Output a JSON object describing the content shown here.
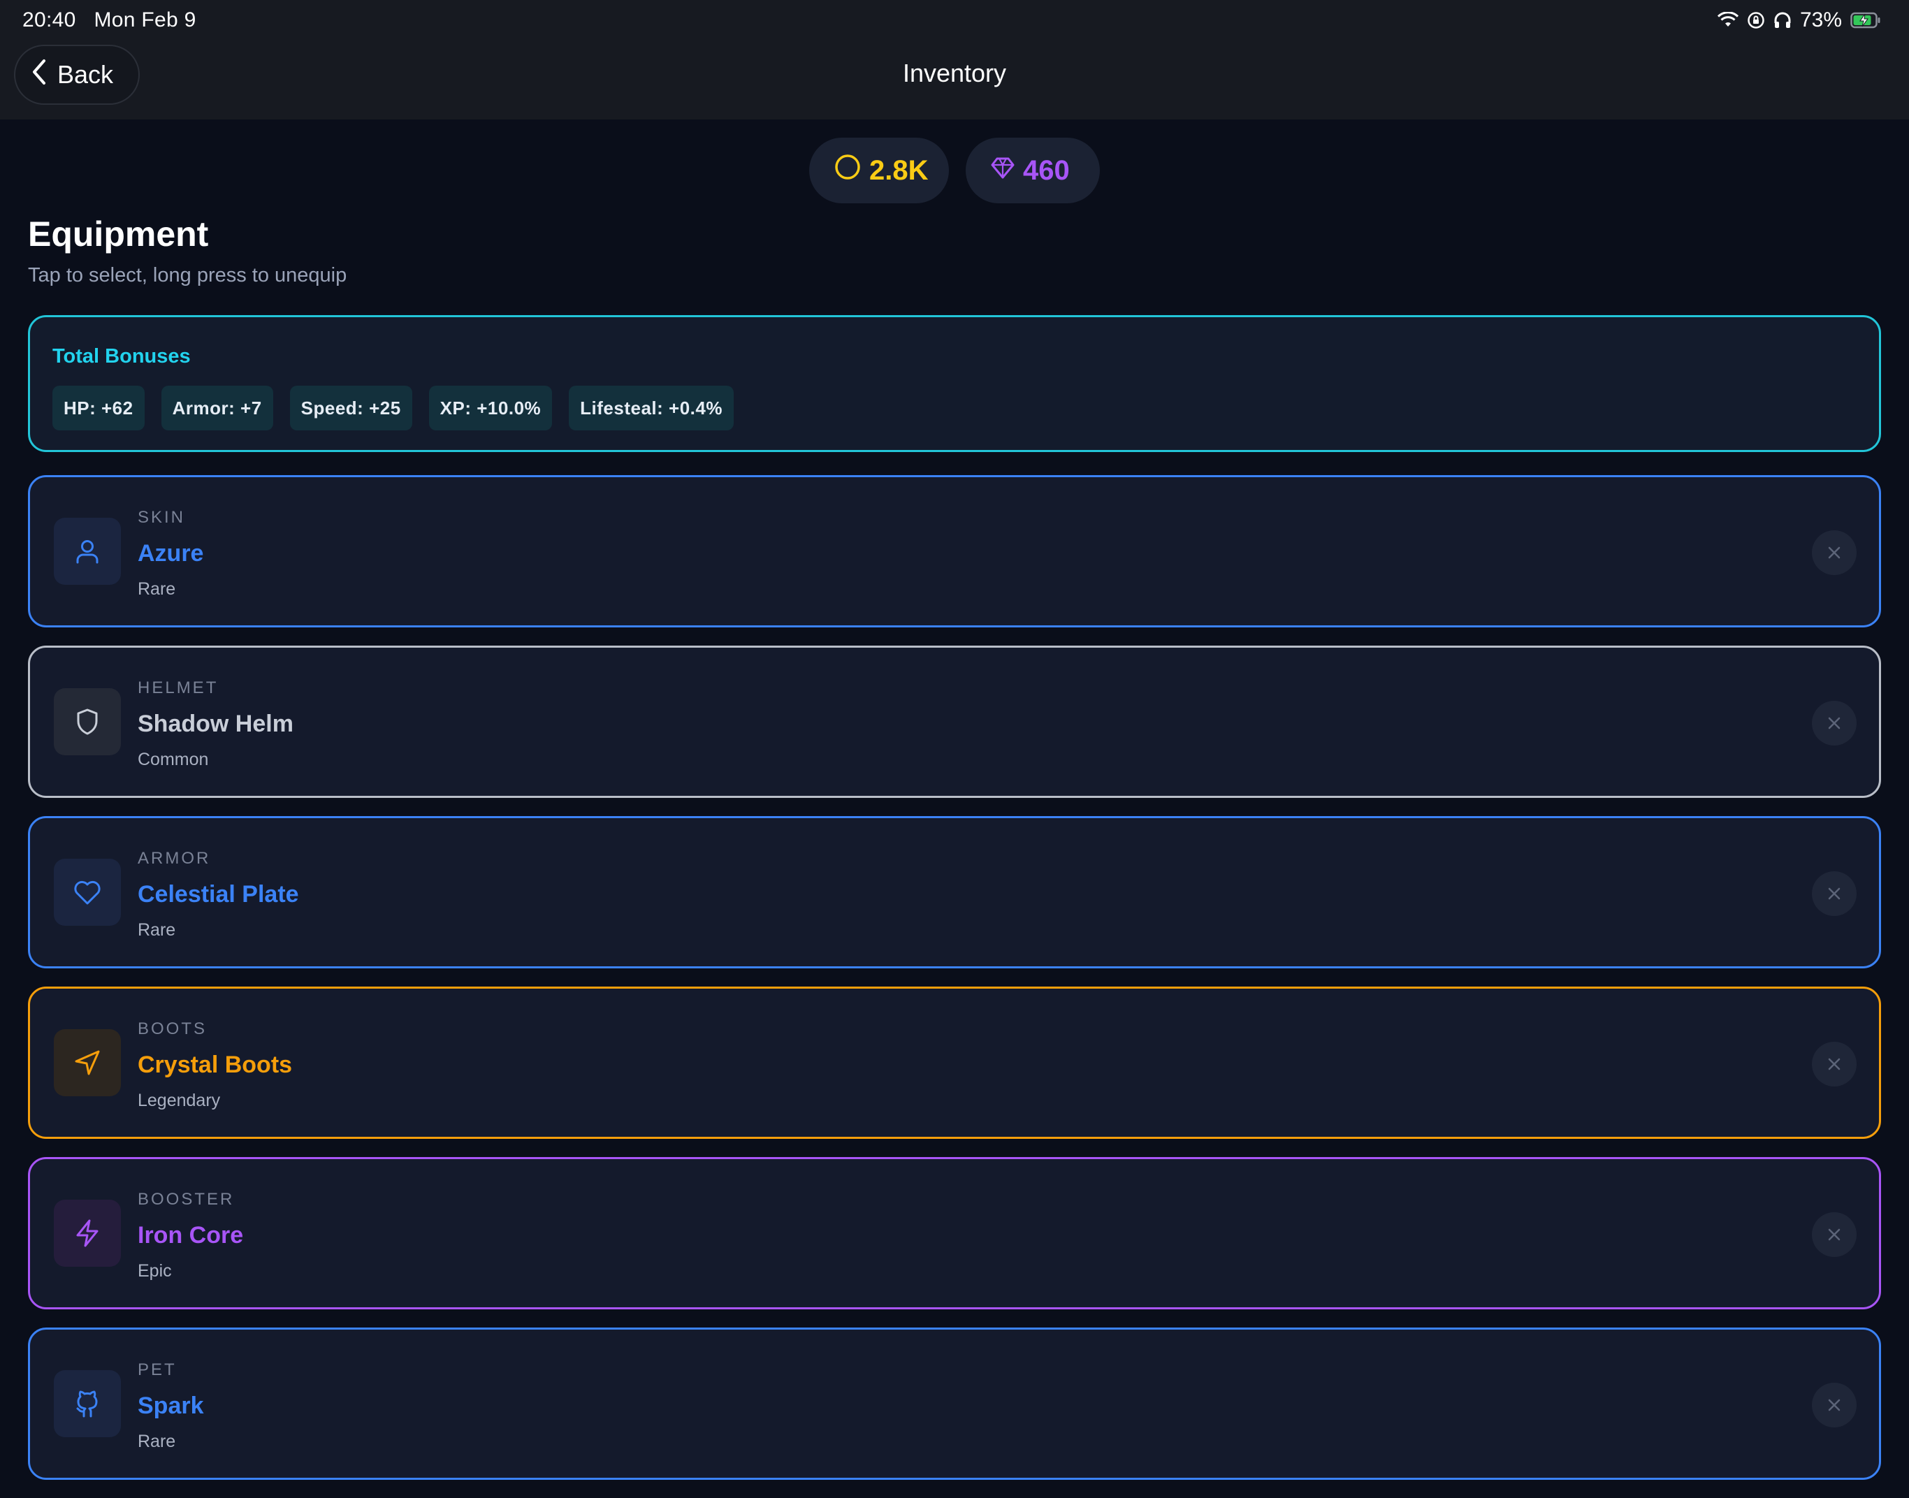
{
  "status_bar": {
    "time": "20:40",
    "date": "Mon Feb 9",
    "battery": "73%",
    "icons": [
      "wifi-icon",
      "lock-rotation-icon",
      "headphones-icon",
      "battery-charging-icon"
    ]
  },
  "nav": {
    "back_label": "Back",
    "title": "Inventory"
  },
  "currency": {
    "coins": "2.8K",
    "gems": "460"
  },
  "header": {
    "title": "Equipment",
    "subtitle": "Tap to select, long press to unequip"
  },
  "bonuses": {
    "title": "Total Bonuses",
    "chips": [
      "HP: +62",
      "Armor: +7",
      "Speed: +25",
      "XP: +10.0%",
      "Lifesteal: +0.4%"
    ]
  },
  "items": [
    {
      "slot": "SKIN",
      "name": "Azure",
      "rarity": "Rare",
      "icon": "user-icon"
    },
    {
      "slot": "HELMET",
      "name": "Shadow Helm",
      "rarity": "Common",
      "icon": "shield-icon"
    },
    {
      "slot": "ARMOR",
      "name": "Celestial Plate",
      "rarity": "Rare",
      "icon": "heart-icon"
    },
    {
      "slot": "BOOTS",
      "name": "Crystal Boots",
      "rarity": "Legendary",
      "icon": "navigation-arrow-icon"
    },
    {
      "slot": "BOOSTER",
      "name": "Iron Core",
      "rarity": "Epic",
      "icon": "lightning-icon"
    },
    {
      "slot": "PET",
      "name": "Spark",
      "rarity": "Rare",
      "icon": "github-cat-icon"
    }
  ],
  "colors": {
    "background": "#0a0e1a",
    "rare": "#3b82f6",
    "common": "#b9bec8",
    "legendary": "#f59e0b",
    "epic": "#a855f7",
    "bonus_accent": "#22d3ee",
    "coins": "#facc15"
  }
}
